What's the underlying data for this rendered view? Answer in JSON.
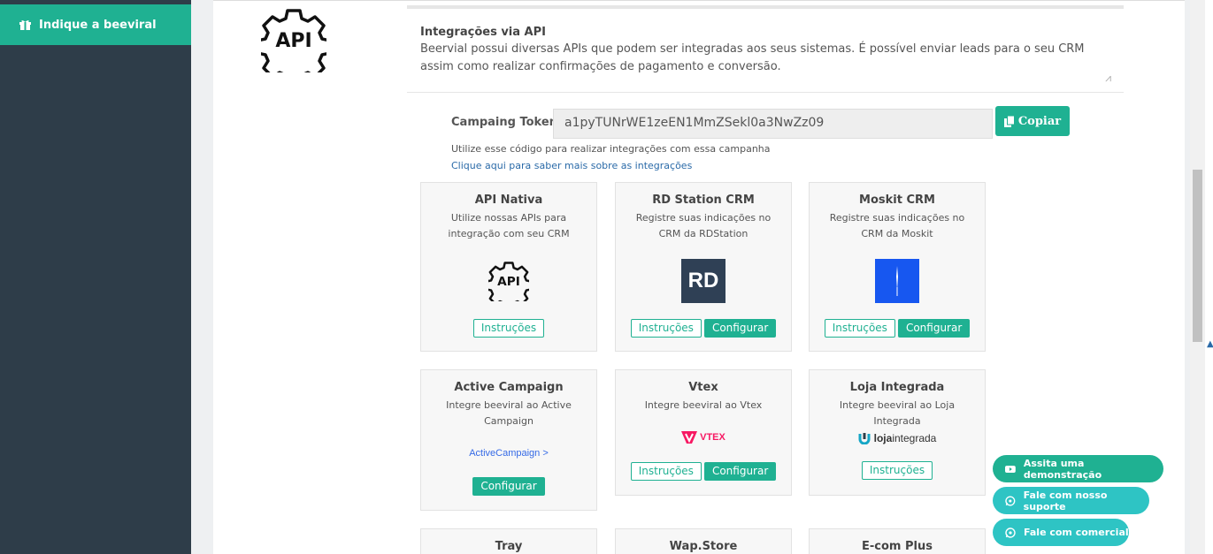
{
  "sidebar": {
    "item_label": "Indique a beeviral"
  },
  "integrations_info": {
    "title": "Integrações via API",
    "description": "Beervial possui diversas APIs que podem ser integradas aos seus sistemas. É possível enviar leads para o seu CRM assim como realizar confirmações de pagamento e conversão."
  },
  "token": {
    "label": "Campaing Token:",
    "value": "a1pyTUNrWE1zeEN1MmZSekl0a3NwZz09",
    "copy_label": "Copiar",
    "help_text": "Utilize esse código para realizar integrações com essa campanha",
    "help_link": "Clique aqui para saber mais sobre as integrações"
  },
  "cards": [
    {
      "title": "API Nativa",
      "desc": "Utilize nossas APIs para integração com seu CRM",
      "logo": "API",
      "btn_instrucoes": "Instruções"
    },
    {
      "title": "RD Station CRM",
      "desc": "Registre suas indicações no CRM da RDStation",
      "logo": "RD",
      "btn_instrucoes": "Instruções",
      "btn_configurar": "Configurar"
    },
    {
      "title": "Moskit CRM",
      "desc": "Registre suas indicações no CRM da Moskit",
      "btn_instrucoes": "Instruções",
      "btn_configurar": "Configurar"
    },
    {
      "title": "Active Campaign",
      "desc": "Integre beeviral ao Active Campaign",
      "logo": "ActiveCampaign >",
      "btn_configurar": "Configurar"
    },
    {
      "title": "Vtex",
      "desc": "Integre beeviral ao Vtex",
      "logo": "VTEX",
      "btn_instrucoes": "Instruções",
      "btn_configurar": "Configurar"
    },
    {
      "title": "Loja Integrada",
      "desc": "Integre beeviral ao Loja Integrada",
      "logo_a": "loja",
      "logo_b": "integrada",
      "btn_instrucoes": "Instruções"
    },
    {
      "title": "Tray"
    },
    {
      "title": "Wap.Store"
    },
    {
      "title": "E-com Plus"
    }
  ],
  "floating": {
    "demo": "Assita uma demonstração",
    "support": "Fale com nosso suporte",
    "sales": "Fale com comercial"
  },
  "colors": {
    "primary": "#1fb192",
    "sidebar": "#2e3d49",
    "float_whatsapp": "#2ec4c4"
  }
}
